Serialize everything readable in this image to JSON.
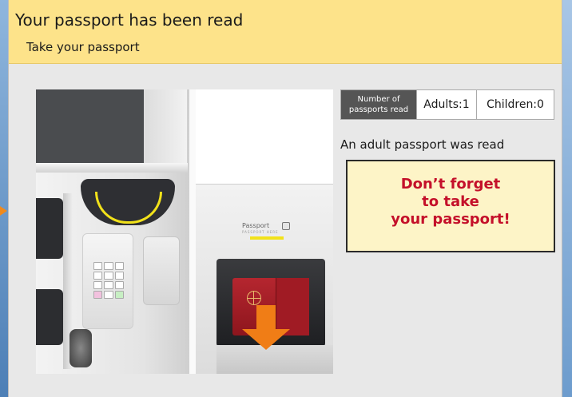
{
  "header": {
    "title": "Your passport has been read",
    "subtitle": "Take your passport"
  },
  "illustration": {
    "passport_label": "Passport",
    "passport_fine_text": "PASSPORT HERE"
  },
  "counts": {
    "header_line1": "Number of",
    "header_line2": "passports read",
    "adults": "Adults:1",
    "children": "Children:0"
  },
  "status_message": "An adult passport was read",
  "notice": {
    "line1": "Don’t forget",
    "line2": "to take",
    "line3": "your passport!"
  },
  "colors": {
    "header_bg": "#fde38a",
    "notice_text": "#c4102a",
    "arrow": "#f07d16",
    "passport": "#a01b24"
  }
}
